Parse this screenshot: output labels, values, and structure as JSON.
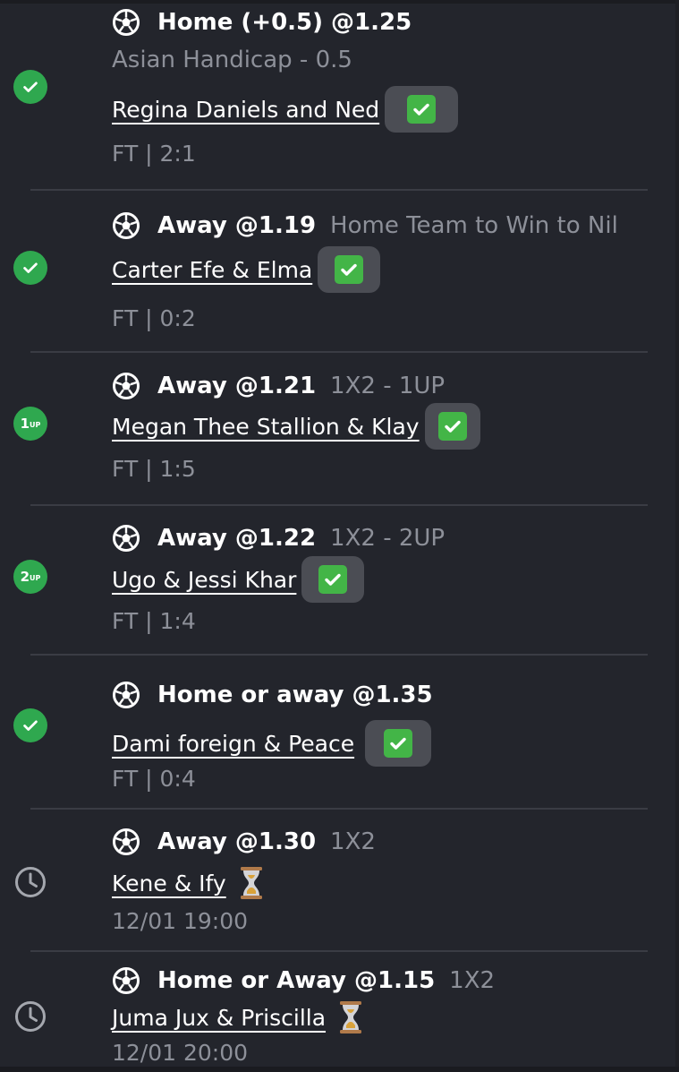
{
  "colors": {
    "background": "#23252c",
    "divider": "#3a3c44",
    "won": "#2fa84f",
    "muted_text": "#8d9099",
    "tick_green": "#43b547"
  },
  "bets": [
    {
      "status_icon": "check-icon",
      "pick": "Home (+0.5) @1.25",
      "market": "Asian Handicap  - 0.5",
      "event": "Regina Daniels and Ned",
      "result_icon": "green-check-emoji",
      "result": "FT | 2:1"
    },
    {
      "status_icon": "check-icon",
      "pick": "Away @1.19",
      "market": "Home Team to Win to Nil",
      "event": "Carter Efe & Elma",
      "result_icon": "green-check-emoji",
      "result": "FT | 0:2"
    },
    {
      "status_icon": "one-up-icon",
      "status_label": "1",
      "status_suffix": "UP",
      "pick": "Away @1.21",
      "market": "1X2 - 1UP",
      "event": "Megan Thee Stallion & Klay",
      "result_icon": "green-check-emoji",
      "result": "FT | 1:5"
    },
    {
      "status_icon": "two-up-icon",
      "status_label": "2",
      "status_suffix": "UP",
      "pick": "Away @1.22",
      "market": "1X2 - 2UP",
      "event": "Ugo & Jessi Khar",
      "result_icon": "green-check-emoji",
      "result": "FT | 1:4"
    },
    {
      "status_icon": "check-icon",
      "pick": "Home or away @1.35",
      "market": "",
      "event": "Dami foreign & Peace",
      "result_icon": "green-check-emoji",
      "result": "FT | 0:4"
    },
    {
      "status_icon": "clock-icon",
      "pick": "Away @1.30",
      "market": "1X2",
      "event": "Kene & Ify",
      "result_icon": "hourglass-icon",
      "result": "12/01 19:00"
    },
    {
      "status_icon": "clock-icon",
      "pick": "Home or Away @1.15",
      "market": "1X2",
      "event": "Juma Jux & Priscilla",
      "result_icon": "hourglass-icon",
      "result": "12/01 20:00"
    }
  ]
}
